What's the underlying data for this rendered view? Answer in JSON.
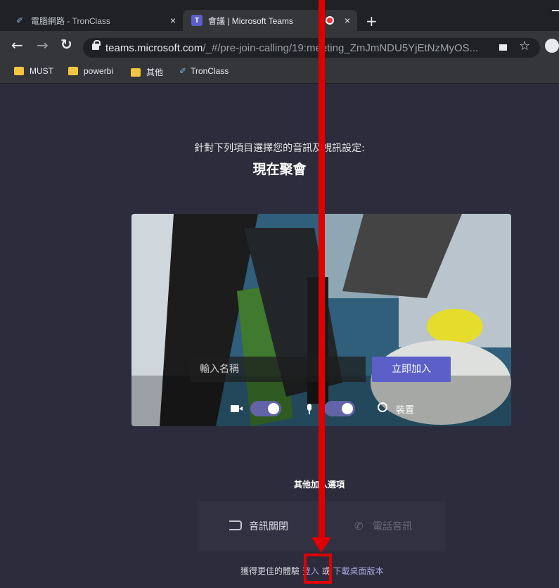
{
  "browser": {
    "tabs": [
      {
        "title": "電腦網路 - TronClass",
        "icon": "tronclass-icon"
      },
      {
        "title": "會議 | Microsoft Teams",
        "icon": "teams-icon"
      }
    ],
    "new_tab_label": "+",
    "close_glyph": "×",
    "url_host": "teams.microsoft.com",
    "url_path": "/_#/pre-join-calling/19:meeting_ZmJmNDU5YjEtNzMyOS...",
    "bookmarks": [
      {
        "label": "MUST",
        "icon": "folder-icon"
      },
      {
        "label": "powerbi",
        "icon": "folder-icon"
      },
      {
        "label": "其他",
        "icon": "folder-icon"
      },
      {
        "label": "TronClass",
        "icon": "tronclass-icon"
      }
    ]
  },
  "prejoin": {
    "subtitle": "針對下列項目選擇您的音訊及視訊設定:",
    "meeting_title": "現在聚會",
    "name_placeholder": "輸入名稱",
    "join_button": "立即加入",
    "video_toggle_on": true,
    "mic_toggle_on": true,
    "devices_label": "裝置",
    "other_options_title": "其他加入選項",
    "audio_off_label": "音訊關閉",
    "phone_audio_label": "電話音訊",
    "footer_prefix": "獲得更佳的體驗",
    "signin_link": "登入",
    "footer_or": "或",
    "download_link": "下載桌面版本"
  },
  "colors": {
    "background": "#2d2c3c",
    "accent": "#6264a7",
    "join_button": "#5b5fc7",
    "annotation": "#e00000"
  }
}
